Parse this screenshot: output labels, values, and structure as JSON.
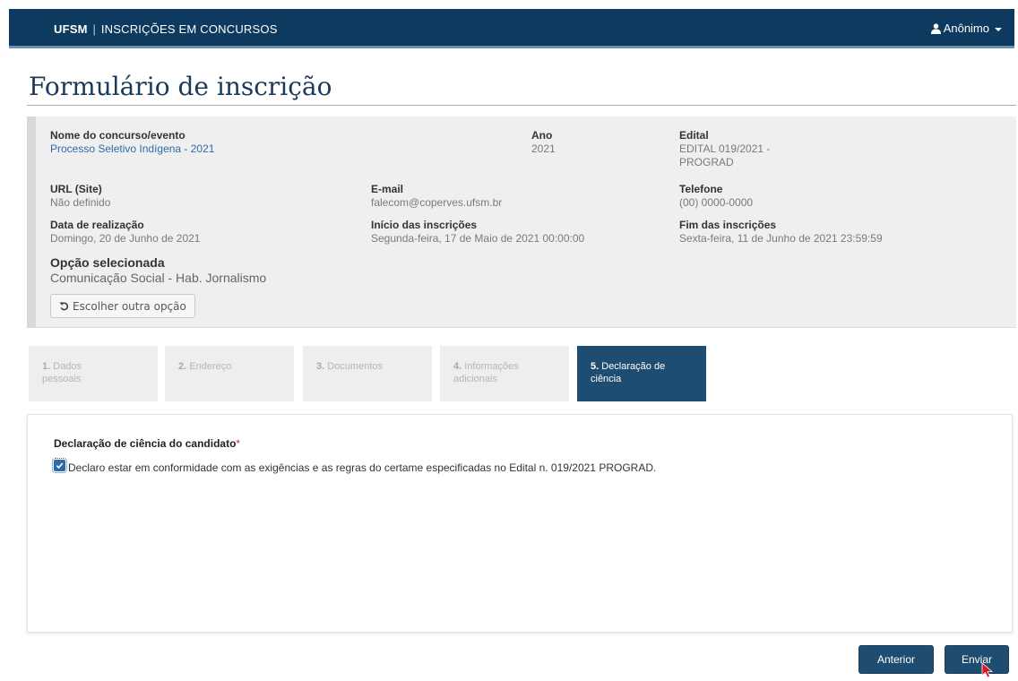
{
  "navbar": {
    "brand_bold": "UFSM",
    "brand_separator": "|",
    "brand_text": "INSCRIÇÕES EM CONCURSOS",
    "user_label": "Anônimo",
    "user_icon": "user-icon",
    "background": "#0e3a5f"
  },
  "page": {
    "title": "Formulário de inscrição"
  },
  "info": {
    "nome": {
      "label": "Nome do concurso/evento",
      "value": "Processo Seletivo Indígena - 2021"
    },
    "ano": {
      "label": "Ano",
      "value": "2021"
    },
    "edital": {
      "label": "Edital",
      "value_line1": "EDITAL 019/2021 -",
      "value_line2": "PROGRAD"
    },
    "url": {
      "label": "URL (Site)",
      "value": "Não definido"
    },
    "email": {
      "label": "E-mail",
      "value": "falecom@coperves.ufsm.br"
    },
    "telefone": {
      "label": "Telefone",
      "value": "(00) 0000-0000"
    },
    "data_realizacao": {
      "label": "Data de realização",
      "value": "Domingo, 20 de Junho de 2021"
    },
    "inicio": {
      "label": "Início das inscrições",
      "value": "Segunda-feira, 17 de Maio de 2021 00:00:00"
    },
    "fim": {
      "label": "Fim das inscrições",
      "value": "Sexta-feira, 11 de Junho de 2021 23:59:59"
    },
    "opcao": {
      "label": "Opção selecionada",
      "value": "Comunicação Social - Hab. Jornalismo"
    },
    "change_button": "Escolher outra opção"
  },
  "steps": [
    {
      "num": "1.",
      "label_line1": "Dados",
      "label_line2": "pessoais",
      "active": false
    },
    {
      "num": "2.",
      "label_line1": "Endereço",
      "label_line2": "",
      "active": false
    },
    {
      "num": "3.",
      "label_line1": "Documentos",
      "label_line2": "",
      "active": false
    },
    {
      "num": "4.",
      "label_line1": "Informações",
      "label_line2": "adicionais",
      "active": false
    },
    {
      "num": "5.",
      "label_line1": "Declaração de",
      "label_line2": "ciência",
      "active": true
    }
  ],
  "declaration": {
    "title": "Declaração de ciência do candidato",
    "required_mark": "*",
    "checked": true,
    "text": "Declaro estar em conformidade com as exigências e as regras do certame especificadas no Edital n. 019/2021 PROGRAD."
  },
  "actions": {
    "previous": "Anterior",
    "submit": "Enviar"
  }
}
